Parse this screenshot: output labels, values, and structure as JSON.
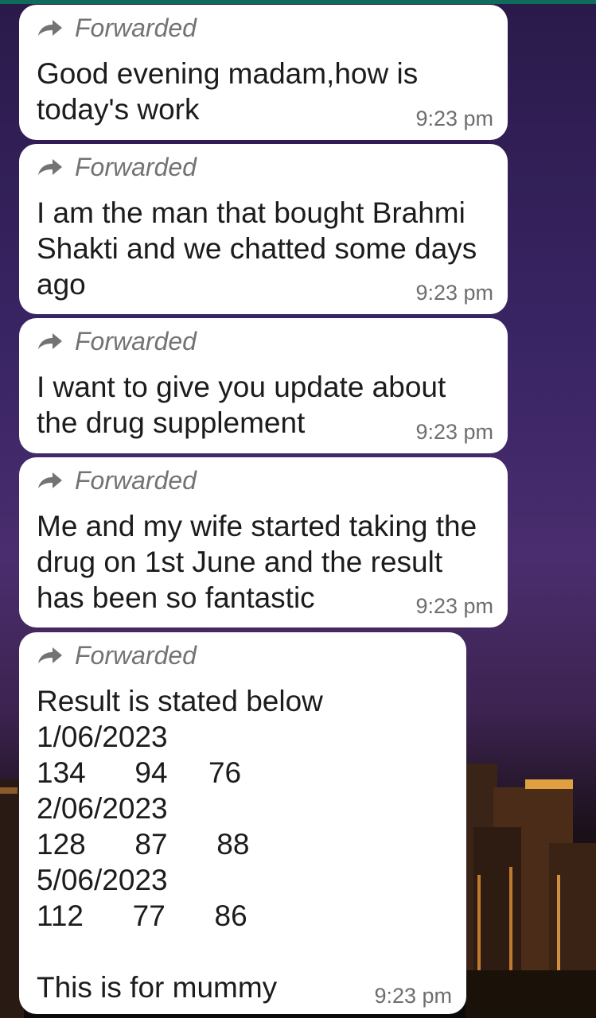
{
  "forwarded_label": "Forwarded",
  "messages": [
    {
      "lines": [
        "Good evening madam,how is",
        "today's work"
      ],
      "time": "9:23 pm"
    },
    {
      "lines": [
        "I am the man that bought Brahmi",
        "Shakti and we chatted some days",
        "ago"
      ],
      "time": "9:23 pm"
    },
    {
      "lines": [
        "I want to give you update about",
        "the drug supplement"
      ],
      "time": "9:23 pm"
    },
    {
      "lines": [
        "Me and my wife started taking the",
        "drug on 1st June and the result",
        "has been so fantastic"
      ],
      "time": "9:23 pm"
    },
    {
      "lines": [
        "Result is stated below",
        "1/06/2023",
        "134      94     76",
        "2/06/2023",
        "128      87      88",
        "5/06/2023",
        "112      77      86",
        "",
        "This is for mummy"
      ],
      "time": "9:23 pm"
    }
  ],
  "colors": {
    "header_strip": "#0f6b5c",
    "bubble": "#ffffff",
    "text": "#1c1c1c",
    "meta": "#737373"
  },
  "icons": {
    "forwarded": "forward-arrow-icon"
  }
}
